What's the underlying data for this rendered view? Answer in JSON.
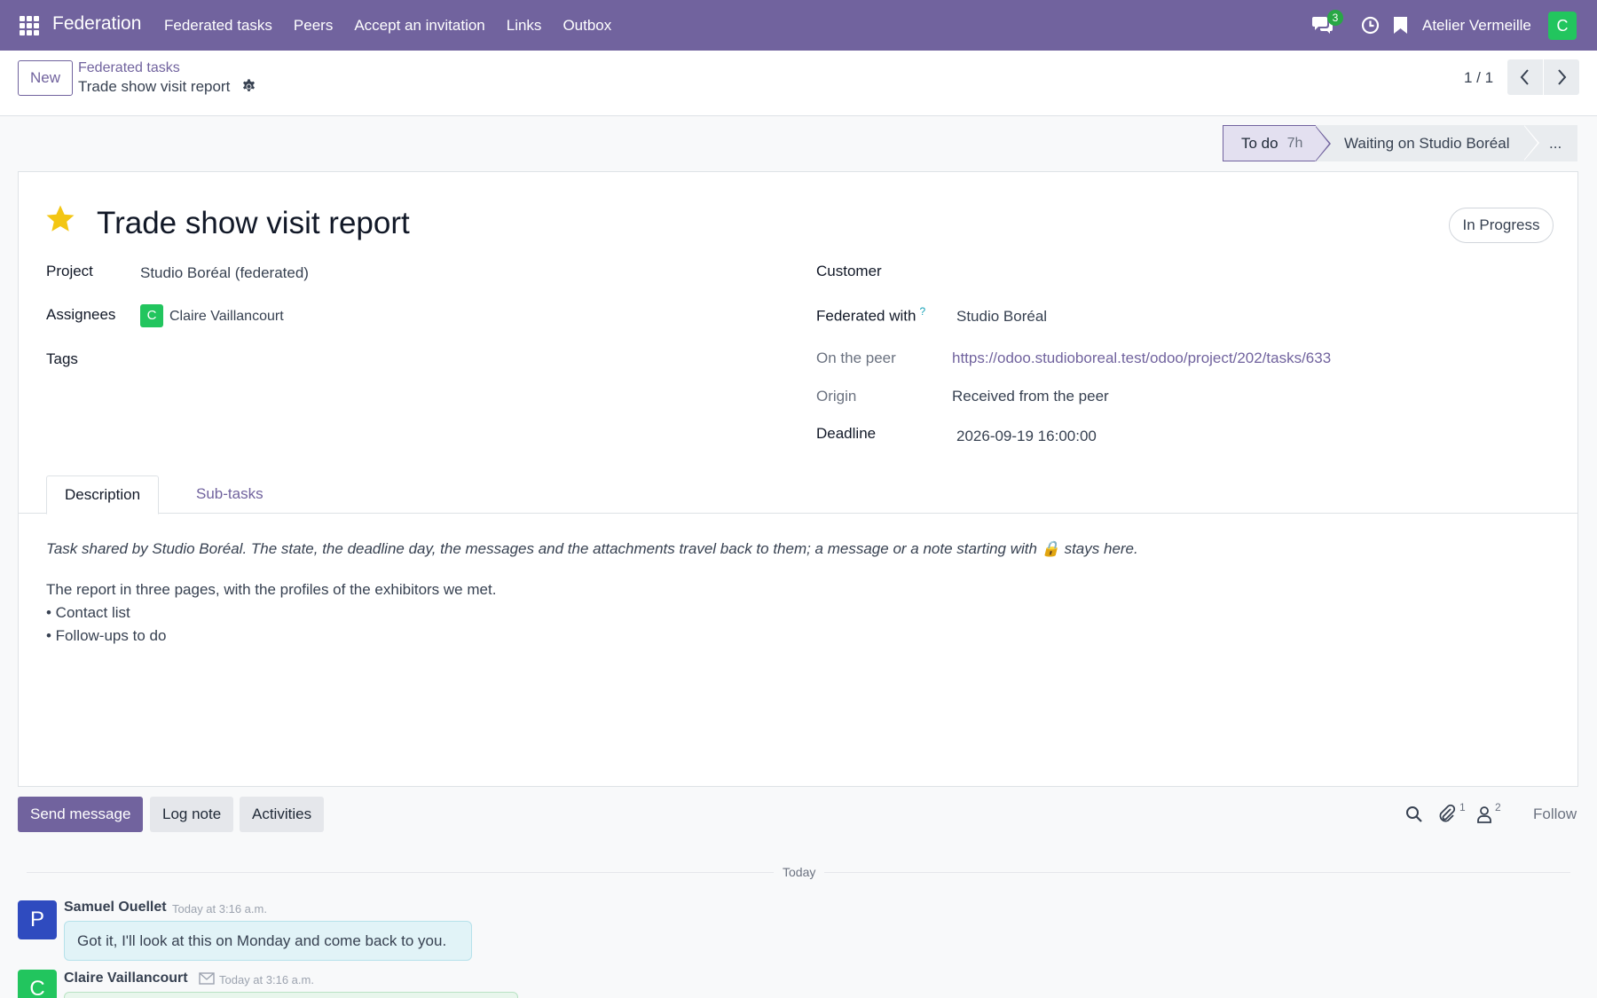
{
  "navbar": {
    "brand": "Federation",
    "menu": [
      "Federated tasks",
      "Peers",
      "Accept an invitation",
      "Links",
      "Outbox"
    ],
    "chat_count": "3",
    "company": "Atelier Vermeille",
    "user_initial": "C"
  },
  "control": {
    "new_label": "New",
    "breadcrumb_parent": "Federated tasks",
    "breadcrumb_current": "Trade show visit report",
    "pager": "1 / 1"
  },
  "statusbar": {
    "stages": [
      {
        "label": "To do",
        "duration": "7h",
        "active": true
      },
      {
        "label": "Waiting on Studio Boréal",
        "active": false
      },
      {
        "label": "...",
        "active": false
      }
    ]
  },
  "record": {
    "starred": true,
    "title": "Trade show visit report",
    "state": "In Progress",
    "fields_left": {
      "project_label": "Project",
      "project_value": "Studio Boréal (federated)",
      "assignees_label": "Assignees",
      "assignee_initial": "C",
      "assignee_name": "Claire Vaillancourt",
      "tags_label": "Tags"
    },
    "fields_right": {
      "customer_label": "Customer",
      "federated_label": "Federated with",
      "federated_help": "?",
      "federated_value": "Studio Boréal",
      "peer_label": "On the peer",
      "peer_url": "https://odoo.studioboreal.test/odoo/project/202/tasks/633",
      "origin_label": "Origin",
      "origin_value": "Received from the peer",
      "deadline_label": "Deadline",
      "deadline_value": "2026-09-19 16:00:00"
    }
  },
  "tabs": {
    "description": "Description",
    "subtasks": "Sub-tasks"
  },
  "description": {
    "note": "Task shared by Studio Boréal. The state, the deadline day, the messages and the attachments travel back to them; a message or a note starting with 🔒 stays here.",
    "lines": [
      "The report in three pages, with the profiles of the exhibitors we met.",
      "• Contact list",
      "• Follow-ups to do"
    ]
  },
  "chatter": {
    "send_message": "Send message",
    "log_note": "Log note",
    "activities": "Activities",
    "attachments_count": "1",
    "followers_count": "2",
    "follow": "Follow",
    "day_label": "Today",
    "messages": [
      {
        "initial": "P",
        "author": "Samuel Ouellet",
        "time": "Today at 3:16 a.m.",
        "body": "Got it, I'll look at this on Monday and come back to you.",
        "avatar_color": "#2f4bbf"
      },
      {
        "initial": "C",
        "author": "Claire Vaillancourt",
        "time": "Today at 3:16 a.m.",
        "body": "",
        "avatar_color": "#22c55e"
      }
    ]
  },
  "colors": {
    "brand": "#71639e",
    "success": "#22c55e",
    "star": "#f3c613"
  }
}
